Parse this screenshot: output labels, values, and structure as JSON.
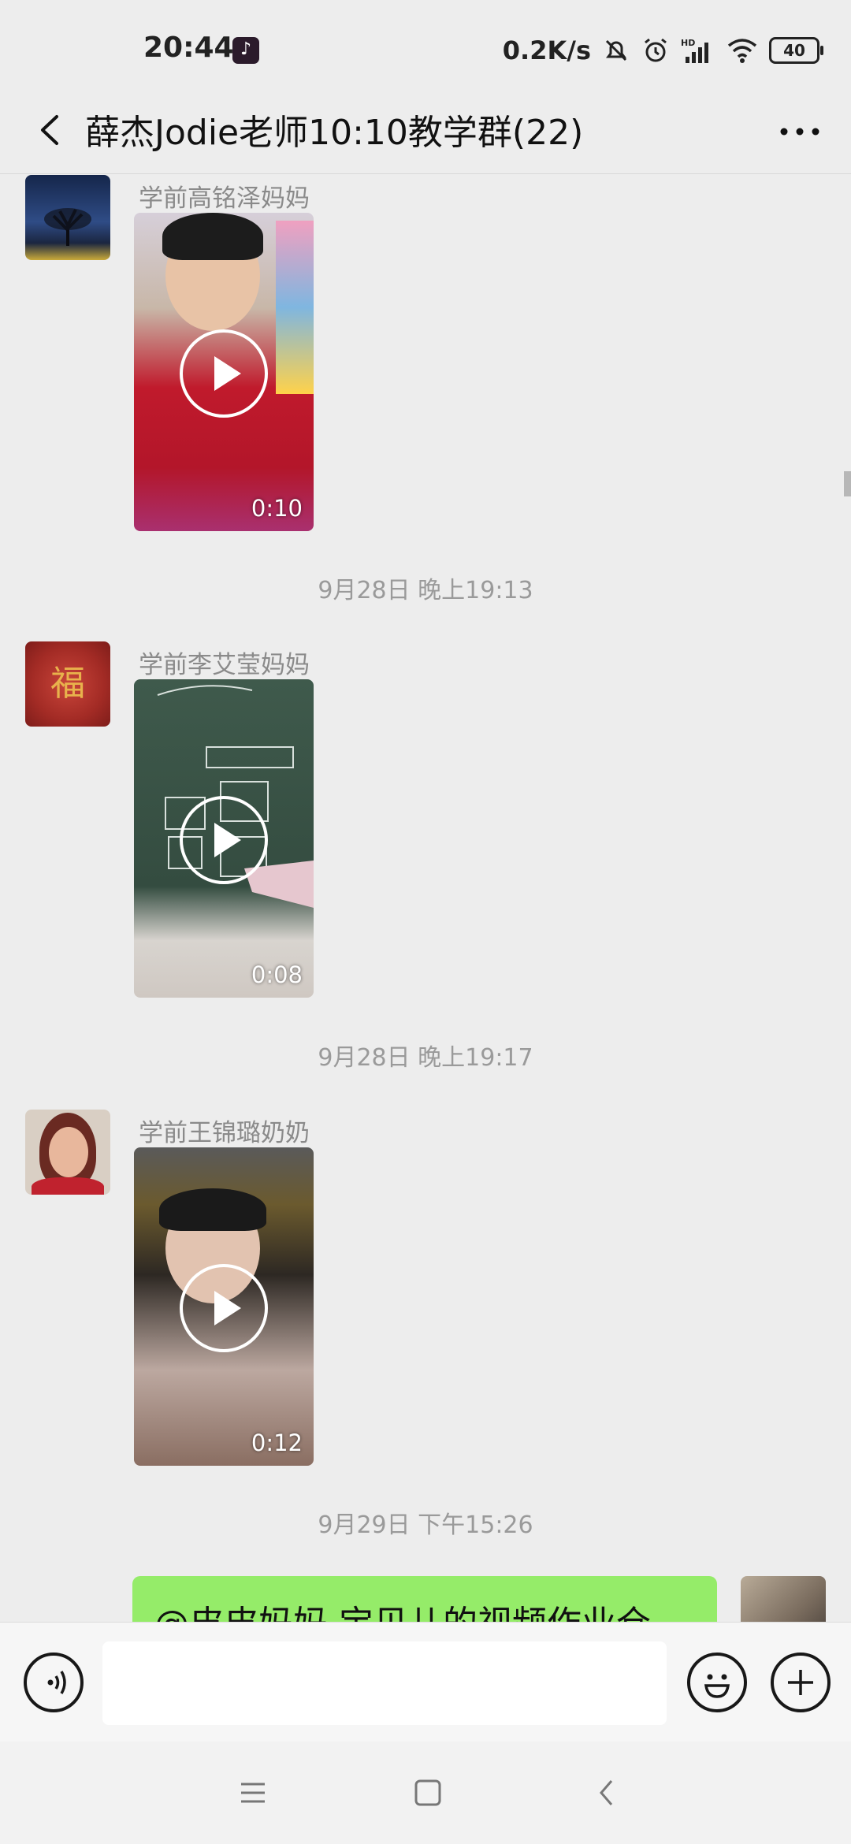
{
  "status_bar": {
    "time": "20:44",
    "speed": "0.2K/s",
    "battery": "40",
    "icons": [
      "tiktok-icon",
      "mute-bell-icon",
      "alarm-icon",
      "hd-signal-icon",
      "wifi-icon",
      "battery-icon"
    ]
  },
  "header": {
    "title": "薛杰Jodie老师10:10教学群(22)",
    "back_icon": "back-chevron-icon",
    "more_icon": "more-dots-icon"
  },
  "messages": [
    {
      "sender": "学前高铭泽妈妈",
      "type": "video",
      "duration": "0:10"
    },
    {
      "timestamp": "9月28日 晚上19:13"
    },
    {
      "sender": "学前李艾莹妈妈",
      "type": "video",
      "duration": "0:08"
    },
    {
      "timestamp": "9月28日 晚上19:17"
    },
    {
      "sender": "学前王锦璐奶奶",
      "type": "video",
      "duration": "0:12"
    },
    {
      "timestamp": "9月29日 下午15:26"
    },
    {
      "type": "text",
      "own": true,
      "text": "@皮皮妈妈 宝贝儿的视频作业仓"
    }
  ],
  "input_bar": {
    "voice_icon": "voice-icon",
    "emoji_icon": "emoji-icon",
    "plus_icon": "plus-icon",
    "input_value": ""
  },
  "colors": {
    "background": "#ededed",
    "own_bubble": "#95ec69",
    "timestamp_text": "#9a9a9a",
    "sender_text": "#8a8a8a"
  }
}
